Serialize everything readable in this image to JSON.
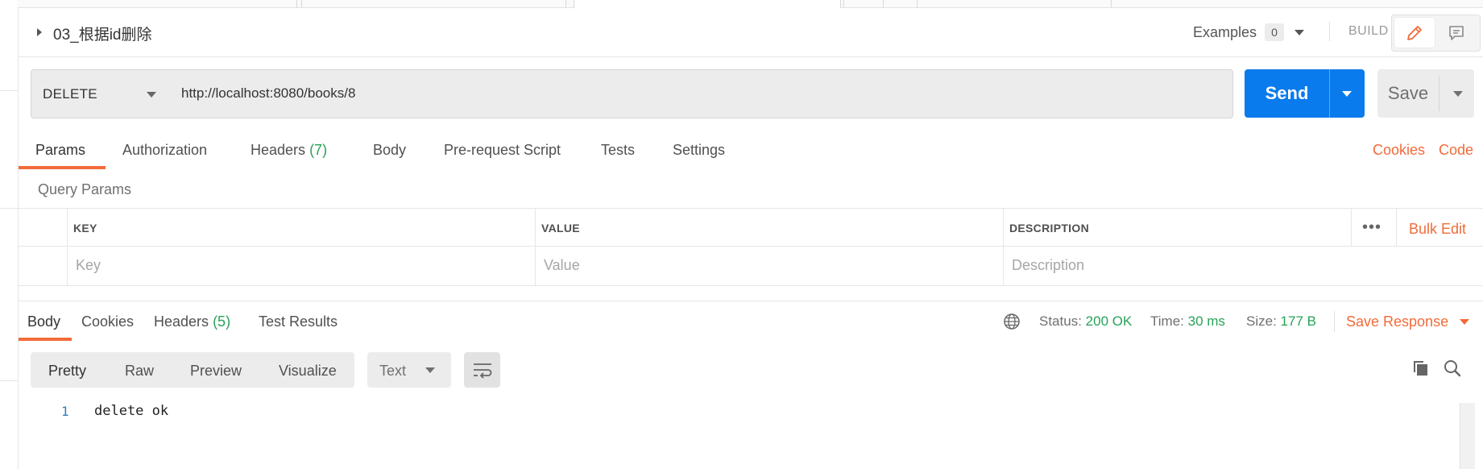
{
  "request": {
    "name": "03_根据id删除",
    "examples_label": "Examples",
    "examples_count": "0",
    "build_label": "BUILD",
    "method": "DELETE",
    "url": "http://localhost:8080/books/8",
    "send_label": "Send",
    "save_label": "Save"
  },
  "request_tabs": {
    "params": "Params",
    "authorization": "Authorization",
    "headers": "Headers",
    "headers_count": "(7)",
    "body": "Body",
    "pre_request": "Pre-request Script",
    "tests": "Tests",
    "settings": "Settings",
    "cookies": "Cookies",
    "code": "Code"
  },
  "query_params": {
    "title": "Query Params",
    "columns": [
      "KEY",
      "VALUE",
      "DESCRIPTION"
    ],
    "placeholders": [
      "Key",
      "Value",
      "Description"
    ],
    "more": "•••",
    "bulk_edit": "Bulk Edit"
  },
  "response": {
    "tabs": {
      "body": "Body",
      "cookies": "Cookies",
      "headers": "Headers",
      "headers_count": "(5)",
      "test_results": "Test Results"
    },
    "status_label": "Status:",
    "status_value": "200 OK",
    "time_label": "Time:",
    "time_value": "30 ms",
    "size_label": "Size:",
    "size_value": "177 B",
    "save_response": "Save Response",
    "view_modes": [
      "Pretty",
      "Raw",
      "Preview",
      "Visualize"
    ],
    "selected_view": "Pretty",
    "format": "Text",
    "lines": [
      {
        "num": "1",
        "text": "delete ok"
      }
    ]
  },
  "colors": {
    "accent": "#f26b3a",
    "send_blue": "#097bed",
    "success_green": "#26a357"
  },
  "icons": {
    "expand": "caret-right-icon",
    "edit": "pencil-icon",
    "comments": "comment-icon",
    "globe": "globe-icon",
    "wrap": "wrap-lines-icon",
    "copy": "copy-icon",
    "search": "search-icon"
  }
}
